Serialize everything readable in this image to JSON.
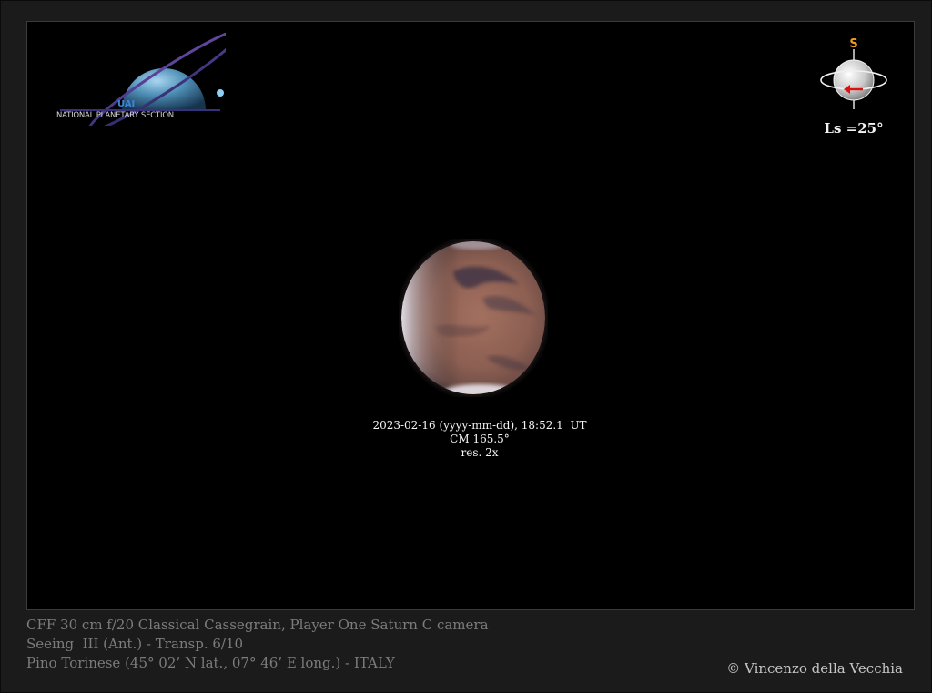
{
  "logo": {
    "abbr": "UAI",
    "name": "NATIONAL PLANETARY SECTION"
  },
  "orientation": {
    "direction_label": "S",
    "ls_label": "Ls =25°",
    "colors": {
      "direction": "#f0a020",
      "arrow": "#e01010"
    }
  },
  "observation": {
    "datetime": "2023-02-16 (yyyy-mm-dd), 18:52.1  UT",
    "cm": "CM 165.5°",
    "resolution": "res. 2x"
  },
  "footer": {
    "line1": "CFF 30 cm f/20 Classical Cassegrain, Player One Saturn C camera",
    "line2": "Seeing  III (Ant.) - Transp. 6/10",
    "line3": "Pino Torinese (45° 02’ N lat., 07° 46’ E long.) - ITALY",
    "copyright": "© Vincenzo della Vecchia"
  }
}
